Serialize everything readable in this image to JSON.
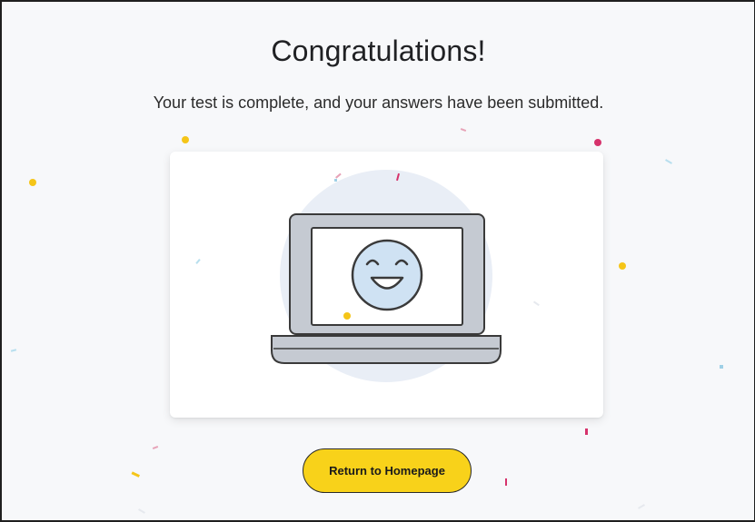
{
  "heading": {
    "title": "Congratulations!",
    "subtitle": "Your test is complete, and your answers have been submitted."
  },
  "actions": {
    "home_label": "Return to Homepage"
  },
  "illustration": {
    "icon": "laptop-smiley-icon",
    "colors": {
      "circle": "#e9eef6",
      "laptop_frame": "#c5cad2",
      "screen": "#ffffff",
      "face": "#cfe2f3",
      "outline": "#3a3a3a"
    }
  },
  "colors": {
    "accent": "#f8d21a",
    "background": "#f7f8fa",
    "confetti_yellow": "#f5c518",
    "confetti_pink": "#d6336c",
    "confetti_blue": "#9fd0e6"
  }
}
